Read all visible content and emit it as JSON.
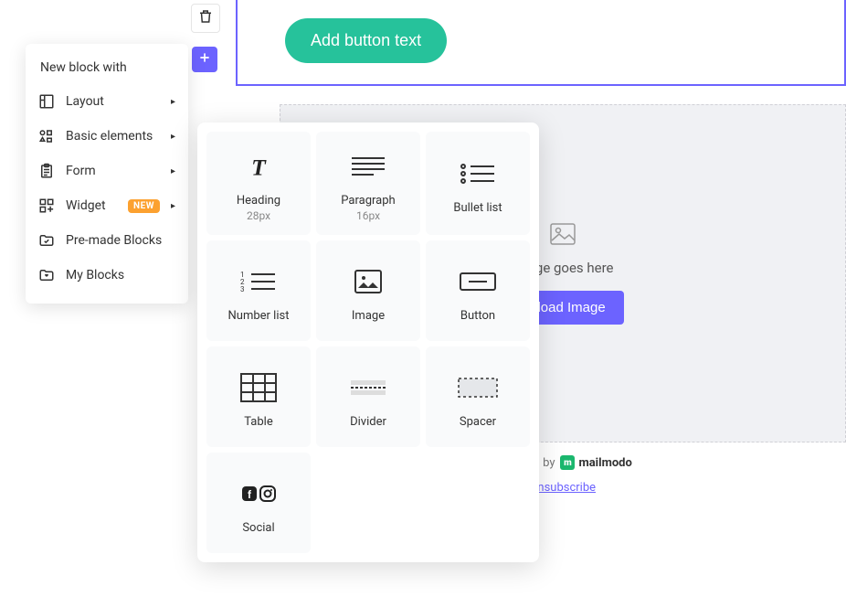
{
  "sidebar": {
    "title": "New block with",
    "items": [
      {
        "label": "Layout",
        "hasSubmenu": true
      },
      {
        "label": "Basic elements",
        "hasSubmenu": true
      },
      {
        "label": "Form",
        "hasSubmenu": true
      },
      {
        "label": "Widget",
        "badge": "NEW",
        "hasSubmenu": true
      },
      {
        "label": "Pre-made Blocks"
      },
      {
        "label": "My Blocks"
      }
    ]
  },
  "elements": {
    "heading": {
      "label": "Heading",
      "sublabel": "28px"
    },
    "paragraph": {
      "label": "Paragraph",
      "sublabel": "16px"
    },
    "bullet_list": {
      "label": "Bullet list"
    },
    "number_list": {
      "label": "Number list"
    },
    "image": {
      "label": "Image"
    },
    "button": {
      "label": "Button"
    },
    "table": {
      "label": "Table"
    },
    "divider": {
      "label": "Divider"
    },
    "spacer": {
      "label": "Spacer"
    },
    "social": {
      "label": "Social"
    }
  },
  "canvas": {
    "button_text": "Add button text",
    "image_placeholder": "Image goes here",
    "upload_label": "Upload Image"
  },
  "footer": {
    "powered_by": "Powered by",
    "brand": "mailmodo",
    "unsubscribe": "Unsubscribe"
  }
}
